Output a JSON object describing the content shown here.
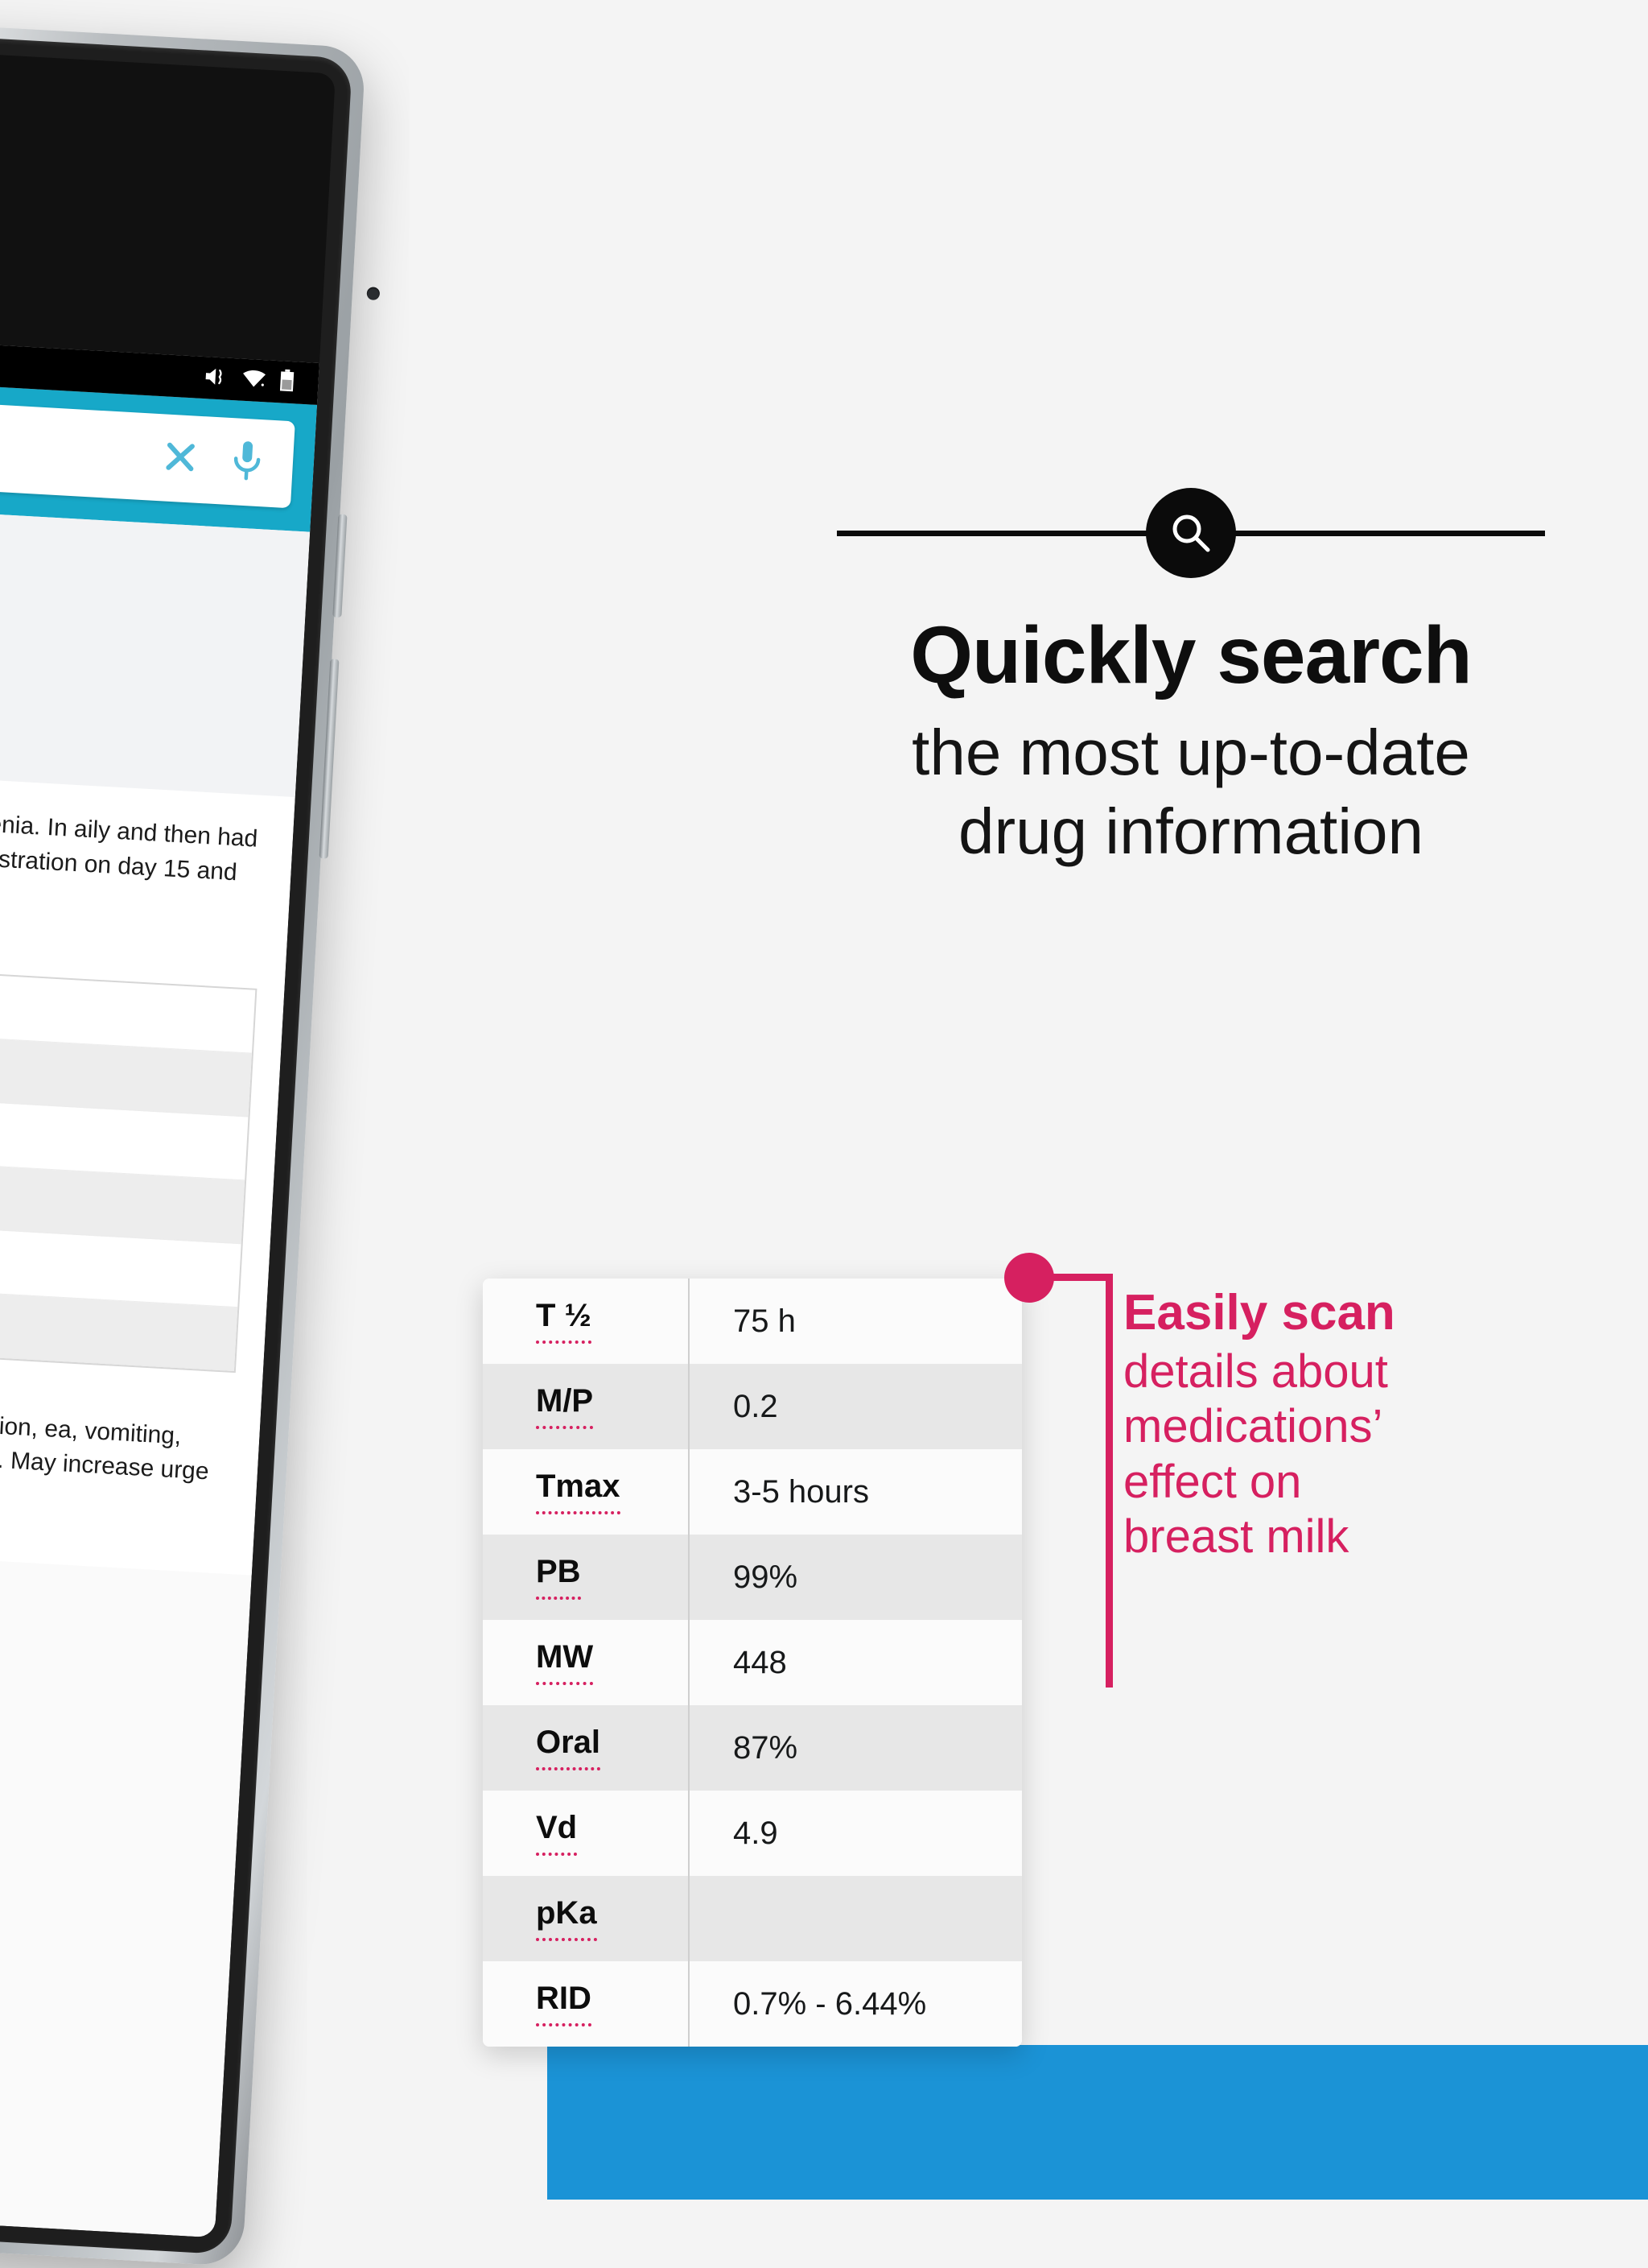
{
  "page": {
    "background_color": "#f4f4f4",
    "accent_pink": "#d62060",
    "accent_blue": "#1b93d6",
    "app_header_cyan": "#17a8c8"
  },
  "device": {
    "status_bar": {
      "icons": [
        "mute-vibrate-icon",
        "wifi-icon",
        "battery-icon"
      ]
    },
    "app": {
      "search": {
        "value": "",
        "placeholder": "",
        "clear_icon": "close-icon",
        "voice_icon": "microphone-icon"
      },
      "article_top": "r the treatment for schizophrenia. In aily and then had a subsequent dose se administration on day 15 and 16",
      "article_bottom": "pain, tachycardia, QTc prolongation, ea, vomiting, constipation, changes in liver or). May increase urge to gamble.",
      "striped_table_rows": 6
    }
  },
  "headline": {
    "icon": "search-icon",
    "title": "Quickly search",
    "subtitle_line1": "the most up-to-date",
    "subtitle_line2": "drug information"
  },
  "callout": {
    "title": "Easily scan",
    "body_line1": "details about",
    "body_line2": "medications’",
    "body_line3": "effect on",
    "body_line4": "breast milk"
  },
  "data_table": {
    "rows": [
      {
        "label": "T ½",
        "value": "75 h"
      },
      {
        "label": "M/P",
        "value": "0.2"
      },
      {
        "label": "Tmax",
        "value": "3-5 hours"
      },
      {
        "label": "PB",
        "value": "99%"
      },
      {
        "label": "MW",
        "value": "448"
      },
      {
        "label": "Oral",
        "value": "87%"
      },
      {
        "label": "Vd",
        "value": "4.9"
      },
      {
        "label": "pKa",
        "value": ""
      },
      {
        "label": "RID",
        "value": "0.7% - 6.44%"
      }
    ]
  }
}
